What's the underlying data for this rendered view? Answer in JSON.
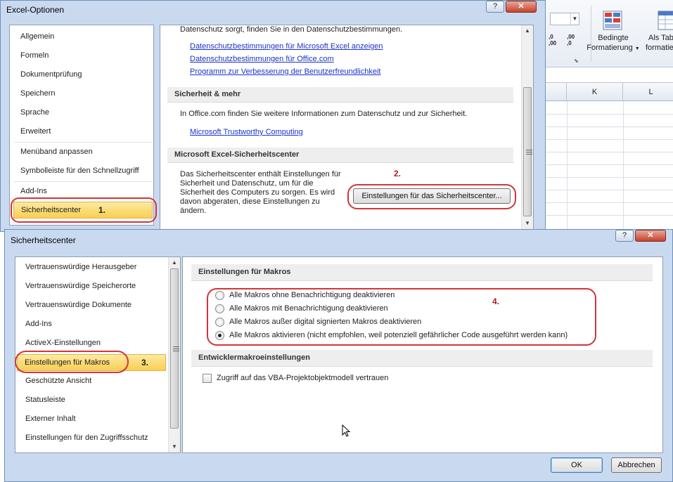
{
  "excel_bg": {
    "ribbon": {
      "conditional_formatting": [
        "Bedingte",
        "Formatierung"
      ],
      "format_as_table": [
        "Als Tab",
        "formatie"
      ],
      "increase_decimal": [
        ",0",
        ",00"
      ],
      "decrease_decimal": [
        ",00",
        ",0"
      ]
    },
    "columns": [
      "K",
      "L"
    ]
  },
  "options_dialog": {
    "title": "Excel-Optionen",
    "title_buttons": {
      "help": "?",
      "close": "✕"
    },
    "sidebar": {
      "items": [
        "Allgemein",
        "Formeln",
        "Dokumentprüfung",
        "Speichern",
        "Sprache",
        "Erweitert",
        "Menüband anpassen",
        "Symbolleiste für den Schnellzugriff",
        "Add-Ins",
        "Sicherheitscenter"
      ],
      "active": "Sicherheitscenter",
      "annotation": "1."
    },
    "content": {
      "top_text": "Datenschutz sorgt, finden Sie in den Datenschutzbestimmungen.",
      "links": [
        "Datenschutzbestimmungen für Microsoft Excel anzeigen",
        "Datenschutzbestimmungen für Office.com",
        "Programm zur Verbesserung der Benutzerfreundlichkeit"
      ],
      "section_security": {
        "header": "Sicherheit & mehr",
        "text": "In Office.com finden Sie weitere Informationen zum Datenschutz und zur Sicherheit.",
        "link": "Microsoft Trustworthy Computing"
      },
      "section_center": {
        "header": "Microsoft Excel-Sicherheitscenter",
        "text": "Das Sicherheitscenter enthält Einstellungen für Sicherheit und Datenschutz, um für die Sicherheit des Computers zu sorgen. Es wird davon abgeraten, diese Einstellungen zu ändern.",
        "button": "Einstellungen für das Sicherheitscenter...",
        "annotation": "2."
      }
    },
    "footer_buttons": {
      "ok": "OK"
    }
  },
  "trust_center": {
    "title": "Sicherheitscenter",
    "title_buttons": {
      "help": "?",
      "close": "✕"
    },
    "sidebar": {
      "items": [
        "Vertrauenswürdige Herausgeber",
        "Vertrauenswürdige Speicherorte",
        "Vertrauenswürdige Dokumente",
        "Add-Ins",
        "ActiveX-Einstellungen",
        "Einstellungen für Makros",
        "Geschützte Ansicht",
        "Statusleiste",
        "Externer Inhalt",
        "Einstellungen für den Zugriffsschutz"
      ],
      "active": "Einstellungen für Makros",
      "annotation": "3."
    },
    "macro_settings": {
      "header": "Einstellungen für Makros",
      "annotation": "4.",
      "options": [
        {
          "label": "Alle Makros ohne Benachrichtigung deaktivieren",
          "selected": false
        },
        {
          "label": "Alle Makros mit Benachrichtigung deaktivieren",
          "selected": false
        },
        {
          "label": "Alle Makros außer digital signierten Makros deaktivieren",
          "selected": false
        },
        {
          "label": "Alle Makros aktivieren (nicht empfohlen, weil potenziell gefährlicher Code ausgeführt werden kann)",
          "selected": true
        }
      ]
    },
    "developer": {
      "header": "Entwicklermakroeinstellungen",
      "checkbox_label": "Zugriff auf das VBA-Projektobjektmodell vertrauen",
      "checked": false
    },
    "buttons": {
      "ok": "OK",
      "cancel": "Abbrechen"
    }
  },
  "colors": {
    "highlight": "#f9cf52",
    "annotation_red": "#d3343a",
    "link": "#1a33c8",
    "dialog_frame": "#c9daf0"
  }
}
